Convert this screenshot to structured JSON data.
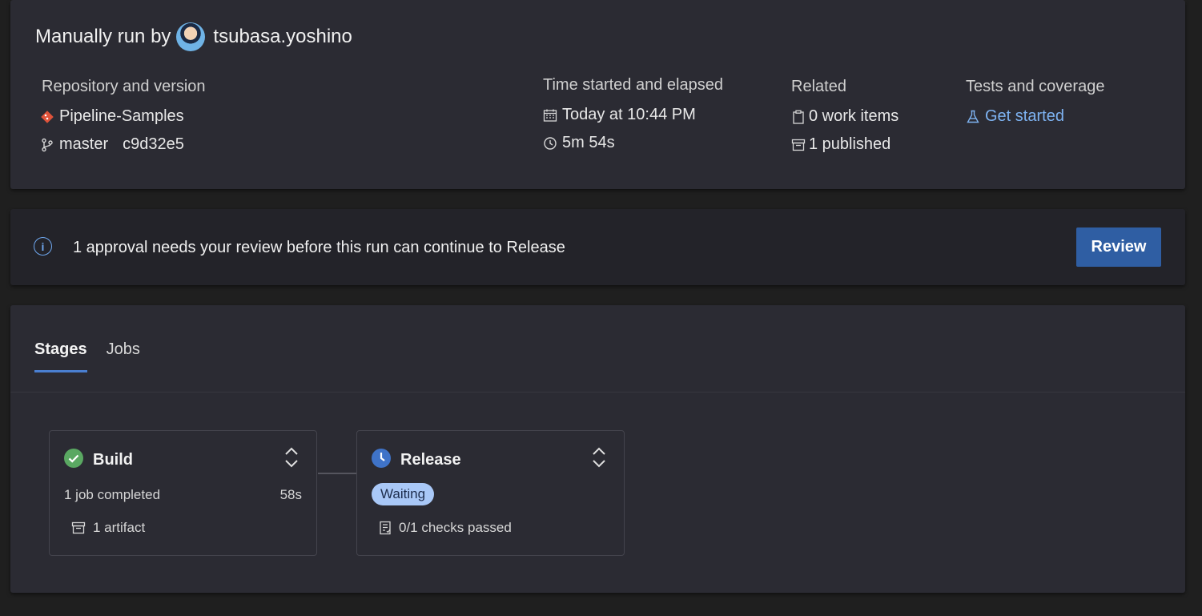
{
  "header": {
    "title_prefix": "Manually run by",
    "user_name": "tsubasa.yoshino"
  },
  "repository": {
    "heading": "Repository and version",
    "name": "Pipeline-Samples",
    "branch": "master",
    "commit": "c9d32e5"
  },
  "time": {
    "heading": "Time started and elapsed",
    "started": "Today at 10:44 PM",
    "elapsed": "5m 54s"
  },
  "related": {
    "heading": "Related",
    "work_items": "0 work items",
    "published": "1 published"
  },
  "tests": {
    "heading": "Tests and coverage",
    "link": "Get started"
  },
  "banner": {
    "message": "1 approval needs your review before this run can continue to Release",
    "button": "Review"
  },
  "tabs": [
    {
      "label": "Stages",
      "active": true
    },
    {
      "label": "Jobs",
      "active": false
    }
  ],
  "stages": [
    {
      "name": "Build",
      "status": "succeeded",
      "summary": "1 job completed",
      "duration": "58s",
      "artifact": "1 artifact"
    },
    {
      "name": "Release",
      "status": "waiting",
      "badge": "Waiting",
      "checks": "0/1 checks passed"
    }
  ],
  "colors": {
    "accent": "#2f5ea3",
    "link": "#7eb3f2",
    "success": "#5aa862",
    "waiting": "#3f73c8",
    "git_icon": "#e0533a"
  }
}
